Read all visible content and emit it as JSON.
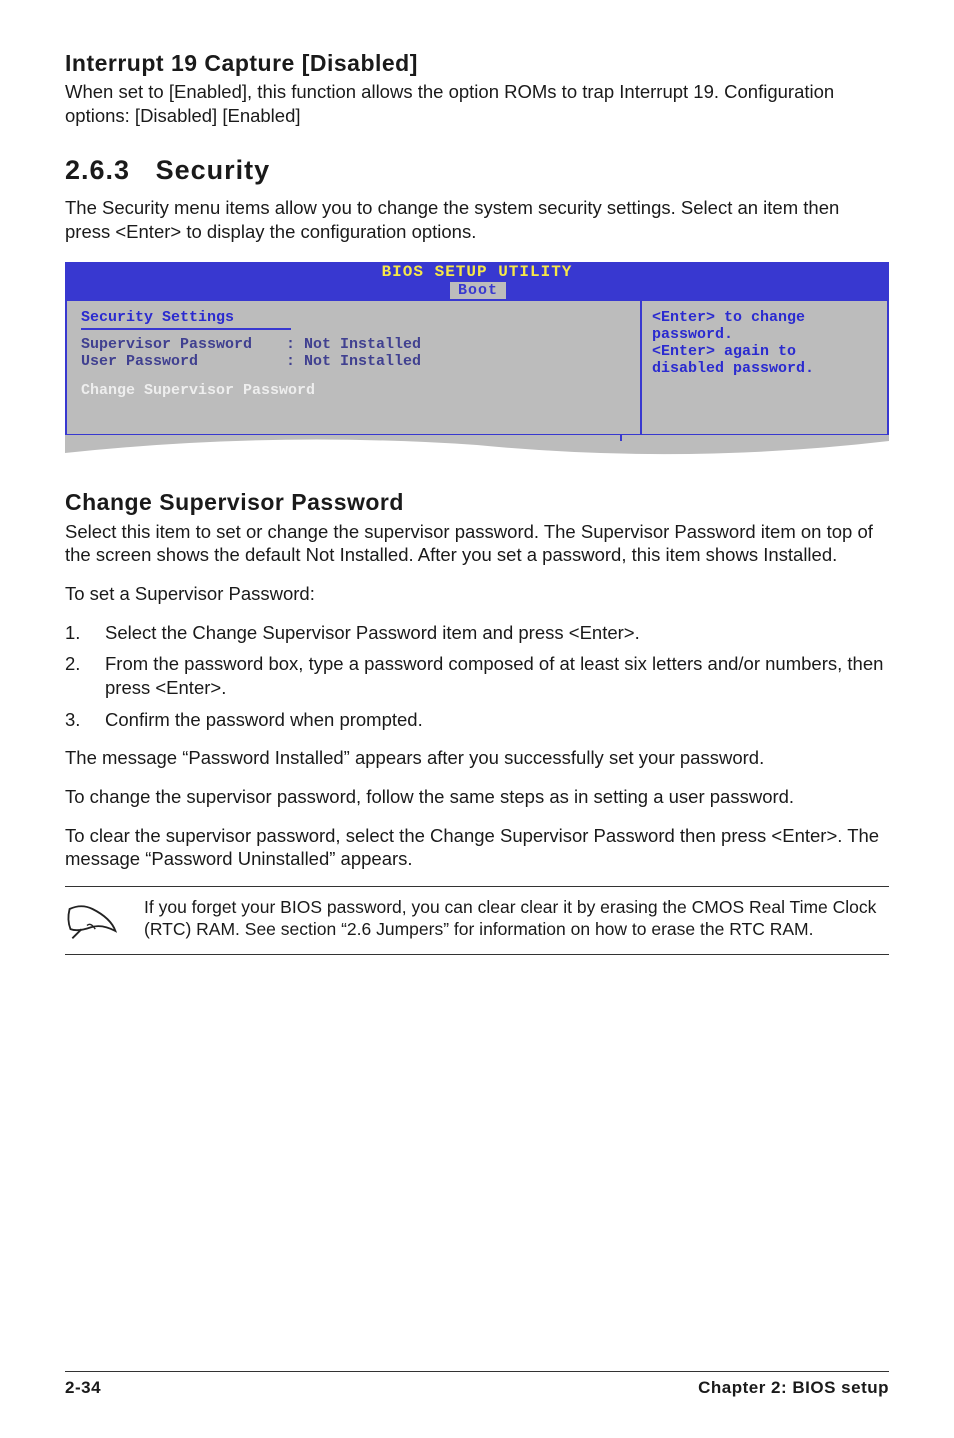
{
  "section1": {
    "title": "Interrupt 19 Capture [Disabled]",
    "body": "When set to [Enabled], this function allows the option ROMs to trap Interrupt 19. Configuration options: [Disabled] [Enabled]"
  },
  "section2": {
    "num": "2.6.3",
    "title": "Security",
    "body": "The Security menu items allow you to change the system security settings. Select an item then press <Enter> to display the configuration options."
  },
  "bios": {
    "title": "BIOS SETUP UTILITY",
    "tab": "Boot",
    "left": {
      "heading": "Security Settings",
      "rows": [
        {
          "label": "Supervisor Password",
          "value": ": Not Installed"
        },
        {
          "label": "User Password",
          "value": ": Not Installed"
        }
      ],
      "change": "Change Supervisor Password"
    },
    "right": {
      "help": "<Enter> to change password.\n<Enter> again to disabled password."
    }
  },
  "section3": {
    "title": "Change Supervisor Password",
    "p1": "Select this item to set or change the supervisor password. The Supervisor Password item on top of the screen shows the default Not Installed. After you set a password, this item shows Installed.",
    "p2": "To set a Supervisor Password:",
    "steps": [
      "Select the Change Supervisor Password item and press <Enter>.",
      "From the password box, type a password composed of at least six letters and/or numbers, then press <Enter>.",
      "Confirm the password when prompted."
    ],
    "p3": "The message “Password Installed” appears after you successfully set your password.",
    "p4": "To change the supervisor password, follow the same steps as in setting a user password.",
    "p5": "To clear the supervisor password, select the Change Supervisor Password then press <Enter>. The message “Password Uninstalled” appears."
  },
  "note": "If you forget your BIOS password, you can clear clear it by erasing the CMOS Real Time Clock (RTC) RAM. See section “2.6  Jumpers” for information on how to erase the RTC RAM.",
  "footer": {
    "left": "2-34",
    "right": "Chapter 2: BIOS setup"
  }
}
